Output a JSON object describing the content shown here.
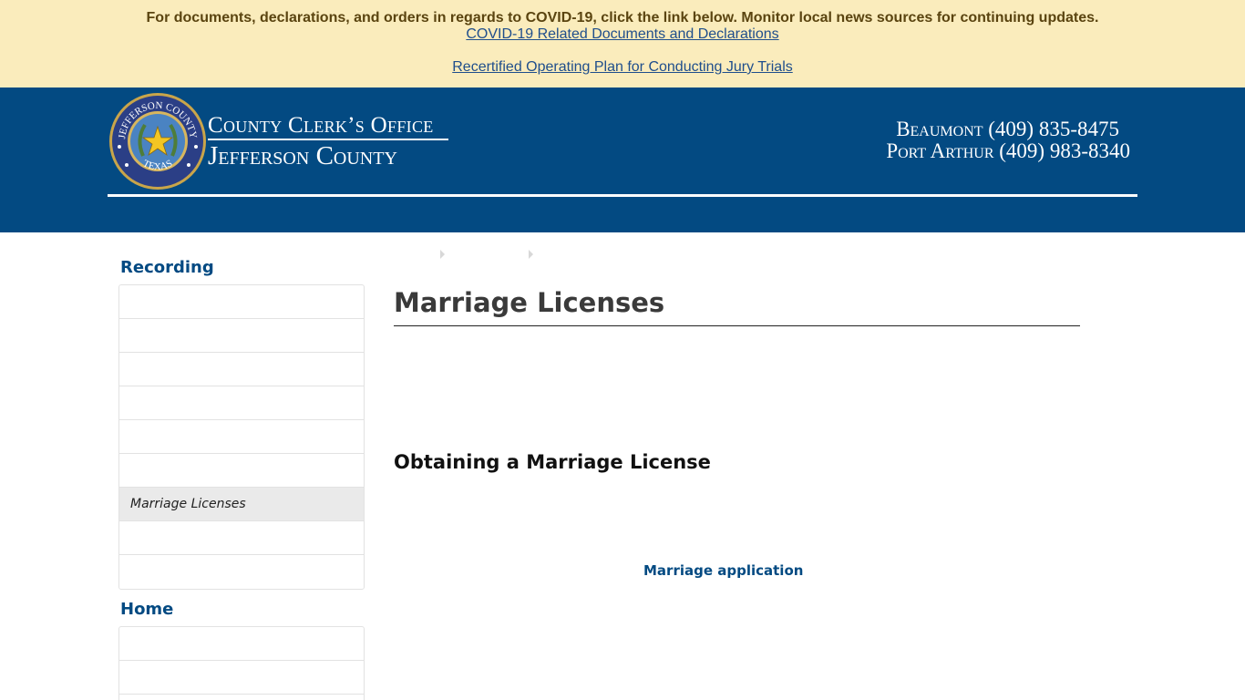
{
  "alert": {
    "message": "For documents, declarations, and orders in regards to COVID-19, click the link below. Monitor local news sources for continuing updates.",
    "link1": "COVID-19 Related Documents and Declarations",
    "link2": "Recertified Operating Plan for Conducting Jury Trials"
  },
  "header": {
    "office": "County Clerk’s Office",
    "county": "Jefferson County",
    "phone_beaumont": "Beaumont (409) 835-8475",
    "phone_port_arthur": "Port Arthur (409) 983-8340",
    "seal": {
      "top_text": "JEFFERSON COUNTY",
      "bottom_text": "TEXAS",
      "icon": "star-seal-icon"
    }
  },
  "sidebar": {
    "sections": [
      {
        "heading": "Recording",
        "items": [
          "",
          "",
          "",
          "",
          "",
          "",
          "Marriage Licenses",
          "",
          ""
        ],
        "active_index": 6
      },
      {
        "heading": "Home",
        "items": [
          "",
          "",
          ""
        ]
      }
    ]
  },
  "main": {
    "title": "Marriage Licenses",
    "subheading": "Obtaining a Marriage License",
    "application_link": "Marriage application"
  },
  "colors": {
    "header_bg": "#034a82",
    "alert_bg": "#faecbc",
    "link_blue": "#034a82"
  }
}
